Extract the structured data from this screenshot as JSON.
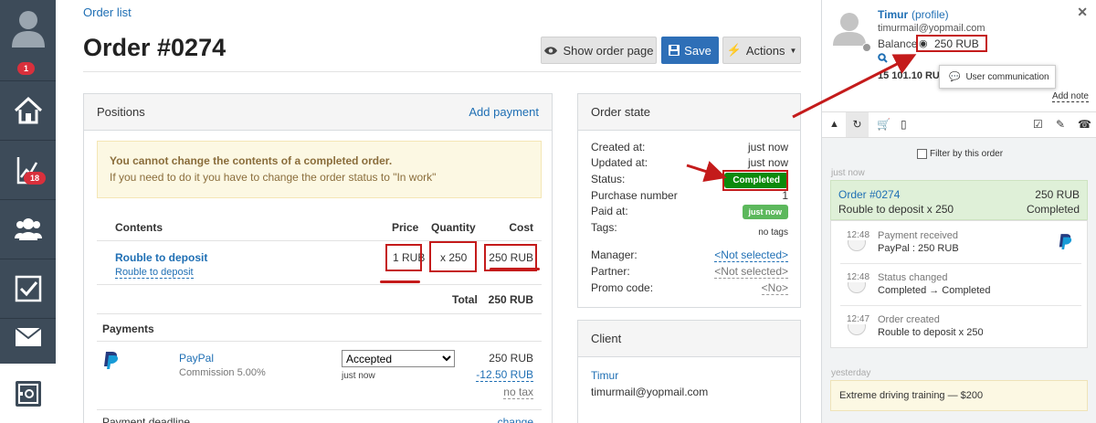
{
  "sidebar": {
    "items": [
      {
        "name": "profile",
        "icon": "user-icon",
        "badge": "1"
      },
      {
        "name": "home",
        "icon": "home-icon",
        "badge": ""
      },
      {
        "name": "analytics",
        "icon": "chart-icon",
        "badge": "18"
      },
      {
        "name": "clients",
        "icon": "users-icon",
        "badge": ""
      },
      {
        "name": "tasks",
        "icon": "checkbox-icon",
        "badge": ""
      },
      {
        "name": "messages",
        "icon": "mail-icon",
        "badge": ""
      },
      {
        "name": "orders",
        "icon": "safe-icon",
        "badge": ""
      }
    ]
  },
  "header": {
    "breadcrumb": "Order list",
    "title": "Order #0274",
    "show_order_page": "Show order page",
    "save": "Save",
    "actions": "Actions"
  },
  "positions": {
    "title": "Positions",
    "add_payment": "Add payment",
    "alert_title": "You cannot change the contents of a completed order.",
    "alert_text": "If you need to do it you have to change the order status to \"In work\"",
    "columns": {
      "contents": "Contents",
      "price": "Price",
      "quantity": "Quantity",
      "cost": "Cost"
    },
    "item": {
      "name": "Rouble to deposit",
      "sub": "Rouble to deposit",
      "price": "1 RUB",
      "quantity": "x 250",
      "cost": "250 RUB"
    },
    "total_label": "Total",
    "total_value": "250 RUB",
    "payments_title": "Payments",
    "payment": {
      "method": "PayPal",
      "commission": "Commission 5.00%",
      "status": "Accepted",
      "status_options": [
        "Accepted"
      ],
      "when": "just now",
      "amount": "250 RUB",
      "fee": "-12.50 RUB",
      "tax": "no tax"
    },
    "deadline_label": "Payment deadline",
    "deadline_change": "change"
  },
  "order_state": {
    "title": "Order state",
    "rows": [
      {
        "label": "Created at:",
        "value": "just now"
      },
      {
        "label": "Updated at:",
        "value": "just now"
      },
      {
        "label": "Status:",
        "value": "Completed"
      },
      {
        "label": "Purchase number",
        "value": "1"
      },
      {
        "label": "Paid at:",
        "value": "just now"
      },
      {
        "label": "Tags:",
        "value": "no tags"
      }
    ],
    "rows2": [
      {
        "label": "Manager:",
        "value": "<Not selected>"
      },
      {
        "label": "Partner:",
        "value": "<Not selected>"
      },
      {
        "label": "Promo code:",
        "value": "<No>"
      }
    ],
    "status_color": "#0b8a0b",
    "paid_color": "#5cb85c"
  },
  "client": {
    "title": "Client",
    "name": "Timur",
    "email": "timurmail@yopmail.com"
  },
  "user_panel": {
    "name": "Timur",
    "profile_link": "(profile)",
    "email": "timurmail@yopmail.com",
    "balance_label": "Balance",
    "balance_value": "250 RUB",
    "amount": "15 101.10 RUB",
    "tooltip": "User communication",
    "add_note": "Add note",
    "filter_label": "Filter by this order",
    "just_now": "just now",
    "order_card": {
      "title": "Order #0274",
      "amount": "250 RUB",
      "desc": "Rouble to deposit x 250",
      "status": "Completed"
    },
    "events": [
      {
        "time": "12:48",
        "title": "Payment received",
        "text": "PayPal : 250 RUB"
      },
      {
        "time": "12:48",
        "title": "Status changed",
        "text": "Completed → Completed"
      },
      {
        "time": "12:47",
        "title": "Order created",
        "text": "Rouble to deposit x 250"
      }
    ],
    "yesterday": "yesterday",
    "yesterday_item": "Extreme driving training — $200"
  },
  "colors": {
    "sidebar": "#3d4b59",
    "accent": "#2e6fb7",
    "badge": "#d9303c",
    "annotation": "#c41b1b",
    "alert_bg": "#fcf8e3",
    "order_card_bg": "#dff0d8"
  }
}
